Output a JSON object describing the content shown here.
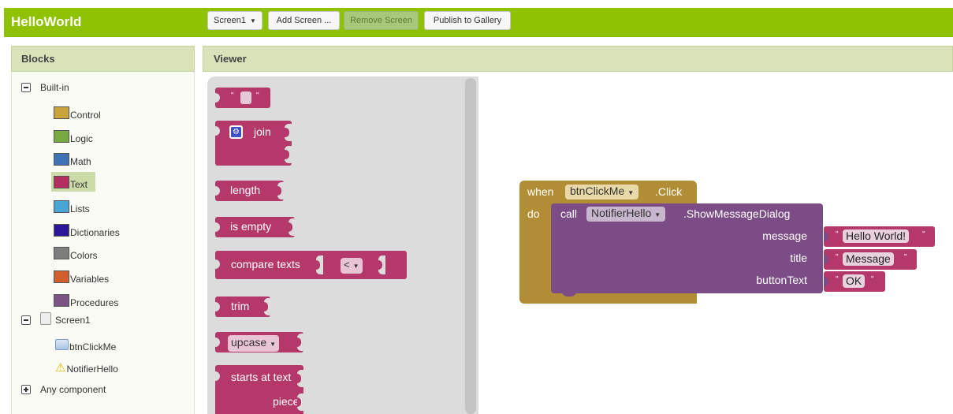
{
  "app": {
    "title": "HelloWorld",
    "brand_color": "#8fc202"
  },
  "toolbar": {
    "screen_select": "Screen1",
    "add_screen": "Add Screen ...",
    "remove_screen": "Remove Screen",
    "publish": "Publish to Gallery"
  },
  "blocks_panel": {
    "header": "Blocks",
    "builtin_label": "Built-in",
    "builtin_items": [
      {
        "label": "Control",
        "color": "#c8a43b"
      },
      {
        "label": "Logic",
        "color": "#77ab41"
      },
      {
        "label": "Math",
        "color": "#3f71b5"
      },
      {
        "label": "Text",
        "color": "#b32d5e"
      },
      {
        "label": "Lists",
        "color": "#49a6d4"
      },
      {
        "label": "Dictionaries",
        "color": "#2d1799"
      },
      {
        "label": "Colors",
        "color": "#7d7d7d"
      },
      {
        "label": "Variables",
        "color": "#d05f2d"
      },
      {
        "label": "Procedures",
        "color": "#7c5385"
      }
    ],
    "screen_label": "Screen1",
    "components": [
      "btnClickMe",
      "NotifierHello"
    ],
    "any_component": "Any component"
  },
  "viewer": {
    "header": "Viewer"
  },
  "flyout": {
    "join": "join",
    "length": "length",
    "is_empty": "is empty",
    "compare_texts": "compare texts",
    "compare_op": "<",
    "trim": "trim",
    "upcase": "upcase",
    "starts_at": "starts at  text",
    "piece": "piece"
  },
  "workspace": {
    "when": "when",
    "component": "btnClickMe",
    "event": ".Click",
    "do": "do",
    "call": "call",
    "notifier": "NotifierHello",
    "method": ".ShowMessageDialog",
    "arg_message": "message",
    "arg_title": "title",
    "arg_button": "buttonText",
    "val_message": "Hello World!",
    "val_title": "Message",
    "val_button": "OK",
    "quote_open": "\"",
    "quote_close": "\""
  }
}
